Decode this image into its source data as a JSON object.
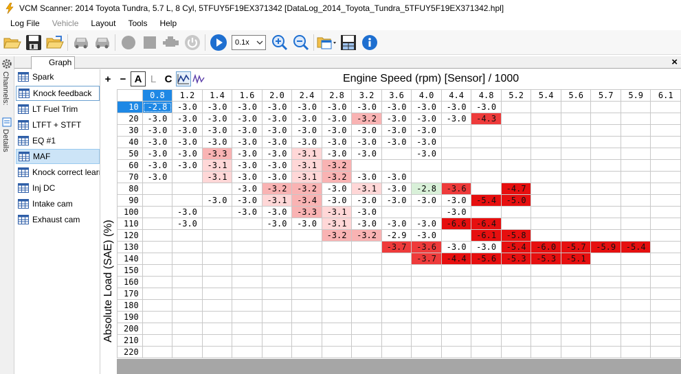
{
  "window": {
    "title": "VCM Scanner: 2014 Toyota Tundra, 5.7 L, 8 Cyl, 5TFUY5F19EX371342 [DataLog_2014_Toyota_Tundra_5TFUY5F19EX371342.hpl]",
    "accent": "#1e88e5"
  },
  "menu": {
    "items": [
      "Log File",
      "Vehicle",
      "Layout",
      "Tools",
      "Help"
    ]
  },
  "toolbar": {
    "playback_speed": "0.1x",
    "icons": [
      "open-folder-icon",
      "save-icon",
      "open-recent-icon",
      "vehicle-icon",
      "vehicle-alt-icon",
      "record-icon",
      "stop-icon",
      "engine-icon",
      "power-icon",
      "play-icon",
      "zoom-in-icon",
      "zoom-out-icon",
      "window-layout-icon",
      "table-save-icon",
      "info-icon"
    ]
  },
  "side_strip": {
    "channels_label": "Channels:",
    "details_label": "Details"
  },
  "tabs": [
    {
      "label": "Graph"
    }
  ],
  "tab_close": "×",
  "channels": [
    {
      "label": "Spark"
    },
    {
      "label": "Knock feedback"
    },
    {
      "label": "LT Fuel Trim"
    },
    {
      "label": "LTFT + STFT"
    },
    {
      "label": "EQ #1"
    },
    {
      "label": "MAF"
    },
    {
      "label": "Knock correct learn"
    },
    {
      "label": "Inj DC"
    },
    {
      "label": "Intake cam"
    },
    {
      "label": "Exhaust cam"
    }
  ],
  "graph_tools": {
    "add": "+",
    "remove": "−",
    "auto": "A",
    "lock": "L",
    "center": "C"
  },
  "table": {
    "x_axis_title": "Engine Speed (rpm) [Sensor] / 1000",
    "y_axis_title": "Absolute Load (SAE) (%)",
    "columns": [
      "0.8",
      "1.2",
      "1.4",
      "1.6",
      "2.0",
      "2.4",
      "2.8",
      "3.2",
      "3.6",
      "4.0",
      "4.4",
      "4.8",
      "5.2",
      "5.4",
      "5.6",
      "5.7",
      "5.9",
      "6.1"
    ],
    "rows": [
      "10",
      "20",
      "30",
      "40",
      "50",
      "60",
      "70",
      "80",
      "90",
      "100",
      "110",
      "120",
      "130",
      "140",
      "150",
      "160",
      "170",
      "180",
      "190",
      "200",
      "210",
      "220"
    ],
    "cells": [
      [
        "-2.8",
        "-3.0",
        "-3.0",
        "-3.0",
        "-3.0",
        "-3.0",
        "-3.0",
        "-3.0",
        "-3.0",
        "-3.0",
        "-3.0",
        "-3.0",
        "",
        "",
        "",
        "",
        "",
        ""
      ],
      [
        "-3.0",
        "-3.0",
        "-3.0",
        "-3.0",
        "-3.0",
        "-3.0",
        "-3.0",
        "-3.2",
        "-3.0",
        "-3.0",
        "-3.0",
        "-4.3",
        "",
        "",
        "",
        "",
        "",
        ""
      ],
      [
        "-3.0",
        "-3.0",
        "-3.0",
        "-3.0",
        "-3.0",
        "-3.0",
        "-3.0",
        "-3.0",
        "-3.0",
        "-3.0",
        "",
        "",
        "",
        "",
        "",
        "",
        "",
        ""
      ],
      [
        "-3.0",
        "-3.0",
        "-3.0",
        "-3.0",
        "-3.0",
        "-3.0",
        "-3.0",
        "-3.0",
        "-3.0",
        "-3.0",
        "",
        "",
        "",
        "",
        "",
        "",
        "",
        ""
      ],
      [
        "-3.0",
        "-3.0",
        "-3.3",
        "-3.0",
        "-3.0",
        "-3.1",
        "-3.0",
        "-3.0",
        "",
        "-3.0",
        "",
        "",
        "",
        "",
        "",
        "",
        "",
        ""
      ],
      [
        "-3.0",
        "-3.0",
        "-3.1",
        "-3.0",
        "-3.0",
        "-3.1",
        "-3.2",
        "",
        "",
        "",
        "",
        "",
        "",
        "",
        "",
        "",
        "",
        ""
      ],
      [
        "-3.0",
        "",
        "-3.1",
        "-3.0",
        "-3.0",
        "-3.1",
        "-3.2",
        "-3.0",
        "-3.0",
        "",
        "",
        "",
        "",
        "",
        "",
        "",
        "",
        ""
      ],
      [
        "",
        "",
        "",
        "-3.0",
        "-3.2",
        "-3.2",
        "-3.0",
        "-3.1",
        "-3.0",
        "-2.8",
        "-3.6",
        "",
        "-4.7",
        "",
        "",
        "",
        "",
        ""
      ],
      [
        "",
        "",
        "-3.0",
        "-3.0",
        "-3.1",
        "-3.4",
        "-3.0",
        "-3.0",
        "-3.0",
        "-3.0",
        "-3.0",
        "-5.4",
        "-5.0",
        "",
        "",
        "",
        "",
        ""
      ],
      [
        "",
        "-3.0",
        "",
        "-3.0",
        "-3.0",
        "-3.3",
        "-3.1",
        "-3.0",
        "",
        "",
        "-3.0",
        "",
        "",
        "",
        "",
        "",
        "",
        ""
      ],
      [
        "",
        "-3.0",
        "",
        "",
        "-3.0",
        "-3.0",
        "-3.1",
        "-3.0",
        "-3.0",
        "-3.0",
        "-6.6",
        "-6.4",
        "",
        "",
        "",
        "",
        "",
        ""
      ],
      [
        "",
        "",
        "",
        "",
        "",
        "",
        "-3.2",
        "-3.2",
        "-2.9",
        "-3.0",
        "",
        "-6.1",
        "-5.8",
        "",
        "",
        "",
        "",
        ""
      ],
      [
        "",
        "",
        "",
        "",
        "",
        "",
        "",
        "",
        "-3.7",
        "-3.6",
        "-3.0",
        "-3.0",
        "-5.4",
        "-6.0",
        "-5.7",
        "-5.9",
        "-5.4",
        ""
      ],
      [
        "",
        "",
        "",
        "",
        "",
        "",
        "",
        "",
        "",
        "-3.7",
        "-4.4",
        "-5.6",
        "-5.3",
        "-5.3",
        "-5.1",
        "",
        "",
        ""
      ],
      [
        "",
        "",
        "",
        "",
        "",
        "",
        "",
        "",
        "",
        "",
        "",
        "",
        "",
        "",
        "",
        "",
        "",
        ""
      ],
      [
        "",
        "",
        "",
        "",
        "",
        "",
        "",
        "",
        "",
        "",
        "",
        "",
        "",
        "",
        "",
        "",
        "",
        ""
      ],
      [
        "",
        "",
        "",
        "",
        "",
        "",
        "",
        "",
        "",
        "",
        "",
        "",
        "",
        "",
        "",
        "",
        "",
        ""
      ],
      [
        "",
        "",
        "",
        "",
        "",
        "",
        "",
        "",
        "",
        "",
        "",
        "",
        "",
        "",
        "",
        "",
        "",
        ""
      ],
      [
        "",
        "",
        "",
        "",
        "",
        "",
        "",
        "",
        "",
        "",
        "",
        "",
        "",
        "",
        "",
        "",
        "",
        ""
      ],
      [
        "",
        "",
        "",
        "",
        "",
        "",
        "",
        "",
        "",
        "",
        "",
        "",
        "",
        "",
        "",
        "",
        "",
        ""
      ],
      [
        "",
        "",
        "",
        "",
        "",
        "",
        "",
        "",
        "",
        "",
        "",
        "",
        "",
        "",
        "",
        "",
        "",
        ""
      ],
      [
        "",
        "",
        "",
        "",
        "",
        "",
        "",
        "",
        "",
        "",
        "",
        "",
        "",
        "",
        "",
        "",
        "",
        ""
      ]
    ],
    "colors": {
      "light": "#ffd7d7",
      "medium": "#f9b3b3",
      "strong": "#ee3b3b",
      "max": "#e60f0f",
      "positive": "#d8f0d8",
      "selected": "#1e88e5"
    }
  }
}
